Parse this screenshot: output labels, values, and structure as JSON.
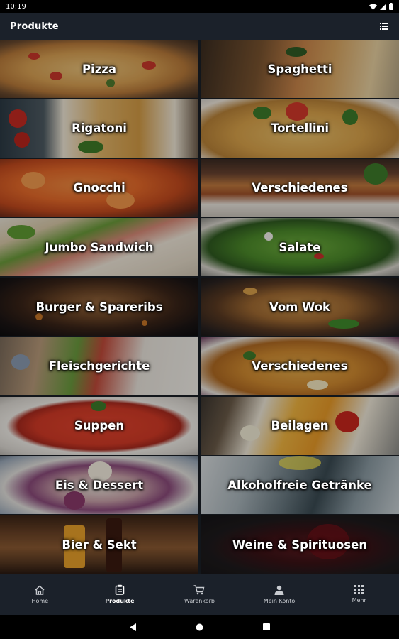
{
  "status": {
    "time": "10:19"
  },
  "app": {
    "title": "Produkte"
  },
  "categories": [
    {
      "label": "Pizza"
    },
    {
      "label": "Spaghetti"
    },
    {
      "label": "Rigatoni"
    },
    {
      "label": "Tortellini"
    },
    {
      "label": "Gnocchi"
    },
    {
      "label": "Verschiedenes"
    },
    {
      "label": "Jumbo Sandwich"
    },
    {
      "label": "Salate"
    },
    {
      "label": "Burger & Spareribs"
    },
    {
      "label": "Vom Wok"
    },
    {
      "label": "Fleischgerichte"
    },
    {
      "label": "Verschiedenes"
    },
    {
      "label": "Suppen"
    },
    {
      "label": "Beilagen"
    },
    {
      "label": "Eis & Dessert"
    },
    {
      "label": "Alkoholfreie Getränke"
    },
    {
      "label": "Bier & Sekt"
    },
    {
      "label": "Weine & Spirituosen"
    }
  ],
  "nav": [
    {
      "label": "Home",
      "icon": "home-icon"
    },
    {
      "label": "Produkte",
      "icon": "products-icon",
      "active": true
    },
    {
      "label": "Warenkorb",
      "icon": "cart-icon"
    },
    {
      "label": "Mein Konto",
      "icon": "account-icon"
    },
    {
      "label": "Mehr",
      "icon": "more-grid-icon"
    }
  ]
}
